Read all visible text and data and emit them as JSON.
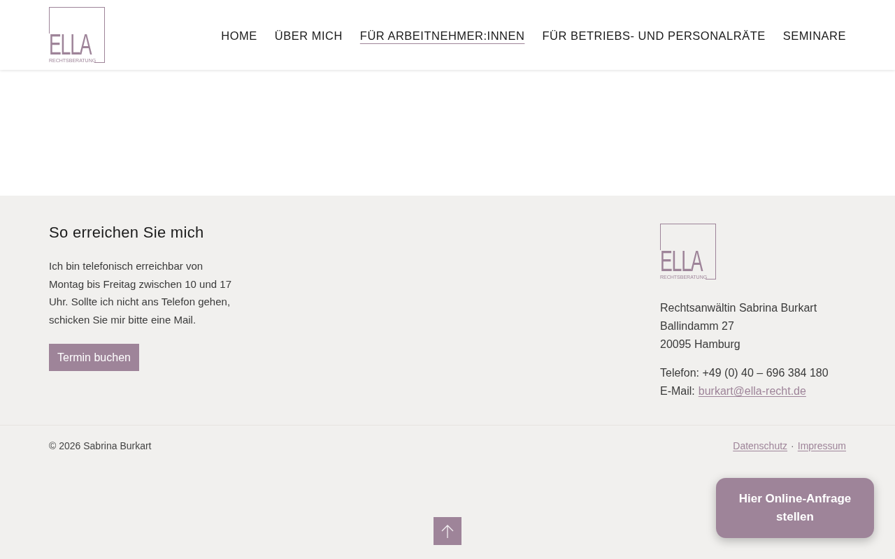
{
  "header": {
    "logo": {
      "wordmark": "ELLA",
      "tagline": "RECHTSBERATUNG"
    },
    "nav": [
      {
        "label": "HOME",
        "selected": false
      },
      {
        "label": "ÜBER MICH",
        "selected": false
      },
      {
        "label": "FÜR ARBEITNEHMER:INNEN",
        "selected": true
      },
      {
        "label": "FÜR BETRIEBS- UND PERSONALRÄTE",
        "selected": false
      },
      {
        "label": "SEMINARE",
        "selected": false
      }
    ]
  },
  "contact": {
    "heading": "So erreichen Sie mich",
    "text": "Ich bin telefonisch erreichbar von Montag bis Freitag zwischen 10 und 17 Uhr. Sollte ich nicht ans Telefon gehen, schicken Sie mir bitte eine Mail.",
    "button": "Termin buchen"
  },
  "address": {
    "logo": {
      "wordmark": "ELLA",
      "tagline": "RECHTSBERATUNG"
    },
    "lines": [
      "Rechtsanwältin Sabrina Burkart",
      "Ballindamm 27",
      "20095 Hamburg"
    ],
    "phone": "Telefon: +49 (0) 40 – 696 384 180",
    "email_label": "E-Mail:",
    "email": "burkart@ella-recht.de"
  },
  "bottom_bar": {
    "copyright": "© 2026 Sabrina Burkart",
    "links": [
      "Datenschutz",
      "Impressum"
    ],
    "separator": "·"
  },
  "inquiry_button": "Hier Online-Anfrage stellen"
}
